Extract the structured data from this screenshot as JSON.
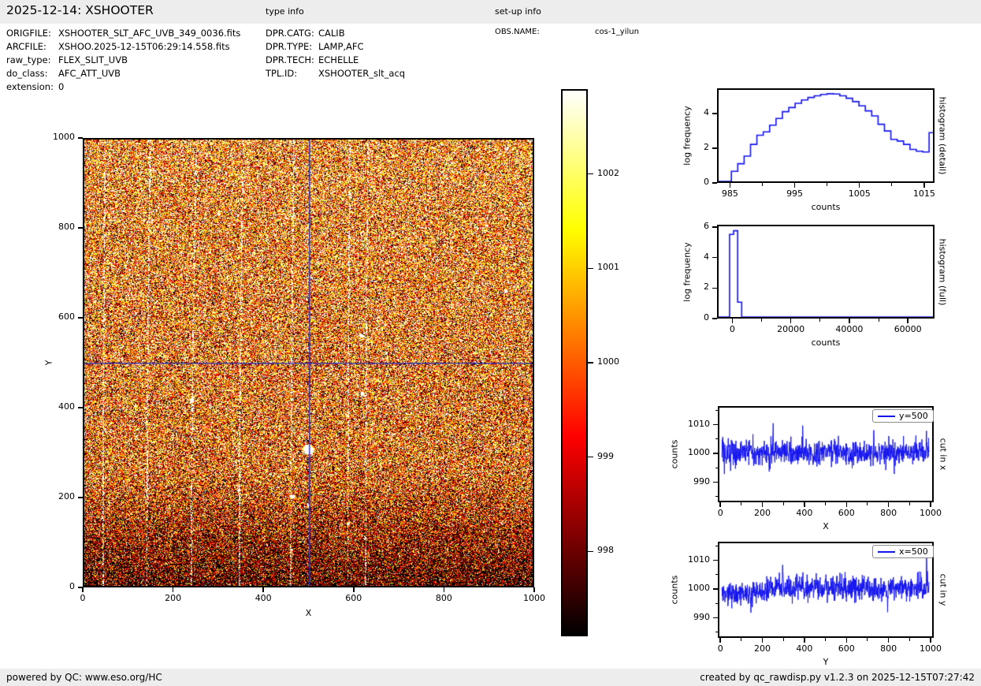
{
  "page": {
    "title": "2025-12-14: XSHOOTER",
    "section_labels": {
      "type_info": "type info",
      "setup_info": "set-up info"
    },
    "footer_left": "powered by QC: www.eso.org/HC",
    "footer_right": "created by qc_rawdisp.py v1.2.3 on 2025-12-15T07:27:42"
  },
  "file_info": [
    {
      "label": "ORIGFILE:",
      "value": "XSHOOTER_SLT_AFC_UVB_349_0036.fits"
    },
    {
      "label": "ARCFILE:",
      "value": "XSHOO.2025-12-15T06:29:14.558.fits"
    },
    {
      "label": "raw_type:",
      "value": "FLEX_SLIT_UVB"
    },
    {
      "label": "do_class:",
      "value": "AFC_ATT_UVB"
    },
    {
      "label": "extension:",
      "value": "0"
    }
  ],
  "type_info": [
    {
      "label": "DPR.CATG:",
      "value": "CALIB"
    },
    {
      "label": "DPR.TYPE:",
      "value": "LAMP,AFC"
    },
    {
      "label": "DPR.TECH:",
      "value": "ECHELLE"
    },
    {
      "label": "TPL.ID:",
      "value": "XSHOOTER_slt_acq"
    }
  ],
  "setup_info": [
    {
      "label": "OBS.NAME:",
      "value": "cos-1_yilun"
    }
  ],
  "colors": {
    "plot_blue": "#1414ee",
    "crosshair_blue": "#2a2ab4",
    "panel_gray": "#ededed",
    "spine_black": "#000000"
  },
  "chart_data": [
    {
      "id": "raw-image",
      "type": "heatmap",
      "xlabel": "X",
      "ylabel": "Y",
      "xlim": [
        0,
        1000
      ],
      "ylim": [
        0,
        1000
      ],
      "x_ticks": [
        0,
        200,
        400,
        600,
        800,
        1000
      ],
      "y_ticks": [
        0,
        200,
        400,
        600,
        800,
        1000
      ],
      "colormap": "hot",
      "vmin": 997.1,
      "vmax": 1002.9,
      "noise_std": 2.4,
      "mean_bottom": 997.5,
      "mean_mid": 1000.1,
      "mean_top": 1000.7,
      "dark_band_until_y": 260,
      "emission_lines_x": [
        41,
        139,
        238,
        345,
        460,
        587,
        627
      ],
      "line_bend": [
        5,
        7,
        12,
        9,
        7,
        5,
        5
      ],
      "crosshair": {
        "x": 500,
        "y": 500
      },
      "bright_spots": [
        [
          500,
          305,
          5,
          26
        ],
        [
          463,
          200,
          2.5,
          18
        ],
        [
          620,
          430,
          2.5,
          16
        ],
        [
          590,
          140,
          2,
          14
        ],
        [
          618,
          560,
          2,
          14
        ],
        [
          940,
          660,
          2,
          12
        ],
        [
          240,
          415,
          2.5,
          16
        ],
        [
          345,
          215,
          2,
          12
        ],
        [
          500,
          180,
          2,
          12
        ],
        [
          463,
          80,
          2,
          12
        ]
      ],
      "seed": 42
    },
    {
      "id": "colorbar",
      "type": "colorbar",
      "colormap": "hot",
      "range": [
        997.1,
        1002.9
      ],
      "ticks": [
        1002,
        1001,
        1000,
        999,
        998
      ]
    },
    {
      "id": "histogram-detail",
      "type": "step",
      "xlabel": "counts",
      "ylabel": "log frequency",
      "right_label": "histogram (detail)",
      "xlim": [
        983,
        1016.6
      ],
      "ylim": [
        0,
        5.45
      ],
      "x_ticks": [
        985,
        995,
        1005,
        1015
      ],
      "x_minor_ticks": [
        990,
        1000,
        1010
      ],
      "y_ticks": [
        0,
        2,
        4
      ],
      "y_minor_ticks": [],
      "bin_start": 984,
      "bin_width": 1,
      "values": [
        0,
        0.6,
        1.05,
        1.5,
        2.2,
        2.75,
        2.95,
        3.35,
        3.75,
        4.15,
        4.4,
        4.65,
        4.85,
        5.0,
        5.1,
        5.18,
        5.22,
        5.2,
        5.1,
        4.95,
        4.75,
        4.5,
        4.2,
        3.9,
        3.4,
        3.0,
        2.5,
        2.4,
        2.2,
        1.9,
        1.8,
        1.75,
        2.9
      ]
    },
    {
      "id": "histogram-full",
      "type": "step",
      "xlabel": "counts",
      "ylabel": "log frequency",
      "right_label": "histogram (full)",
      "xlim": [
        -5200,
        69100
      ],
      "ylim": [
        0,
        6.15
      ],
      "x_ticks": [
        0,
        20000,
        40000,
        60000
      ],
      "x_minor_ticks": [
        10000,
        30000,
        50000
      ],
      "y_ticks": [
        0,
        2,
        4,
        6
      ],
      "y_minor_ticks": [],
      "bin_start": -1400,
      "bin_width": 1400,
      "values": [
        5.6,
        5.85,
        1.0
      ]
    },
    {
      "id": "cut-x",
      "type": "noisy-line",
      "legend": "y=500",
      "xlabel": "X",
      "ylabel": "counts",
      "right_label": "cut in x",
      "xlim": [
        -12,
        1015
      ],
      "ylim": [
        983,
        1016.5
      ],
      "x_ticks": [
        0,
        200,
        400,
        600,
        800,
        1000
      ],
      "x_minor_ticks": [
        100,
        300,
        500,
        700,
        900
      ],
      "y_ticks": [
        990,
        1000,
        1010
      ],
      "y_minor_ticks": [
        985,
        995,
        1005,
        1015
      ],
      "x_range": [
        0,
        1000
      ],
      "mean_profile": [
        [
          0,
          1000.1
        ],
        [
          1000,
          1000.2
        ]
      ],
      "std": 2.3,
      "spikes": [
        [
          247,
          8.5
        ],
        [
          390,
          8
        ],
        [
          988,
          8.5
        ],
        [
          733,
          7
        ],
        [
          12,
          -6
        ],
        [
          228,
          -6.5
        ],
        [
          832,
          -6.5
        ]
      ],
      "seed": 13
    },
    {
      "id": "cut-y",
      "type": "noisy-line",
      "legend": "x=500",
      "xlabel": "Y",
      "ylabel": "counts",
      "right_label": "cut in y",
      "xlim": [
        -12,
        1015
      ],
      "ylim": [
        983,
        1016.5
      ],
      "x_ticks": [
        0,
        200,
        400,
        600,
        800,
        1000
      ],
      "x_minor_ticks": [
        100,
        300,
        500,
        700,
        900
      ],
      "y_ticks": [
        990,
        1000,
        1010
      ],
      "y_minor_ticks": [
        985,
        995,
        1005,
        1015
      ],
      "x_range": [
        0,
        1000
      ],
      "mean_profile": [
        [
          0,
          997.4
        ],
        [
          280,
          1000.3
        ],
        [
          1000,
          1000.5
        ]
      ],
      "std": 2.2,
      "spikes": [
        [
          555,
          9
        ],
        [
          295,
          8
        ],
        [
          800,
          -9.5
        ],
        [
          988,
          7
        ],
        [
          40,
          5
        ],
        [
          130,
          -4
        ]
      ],
      "seed": 29
    }
  ]
}
